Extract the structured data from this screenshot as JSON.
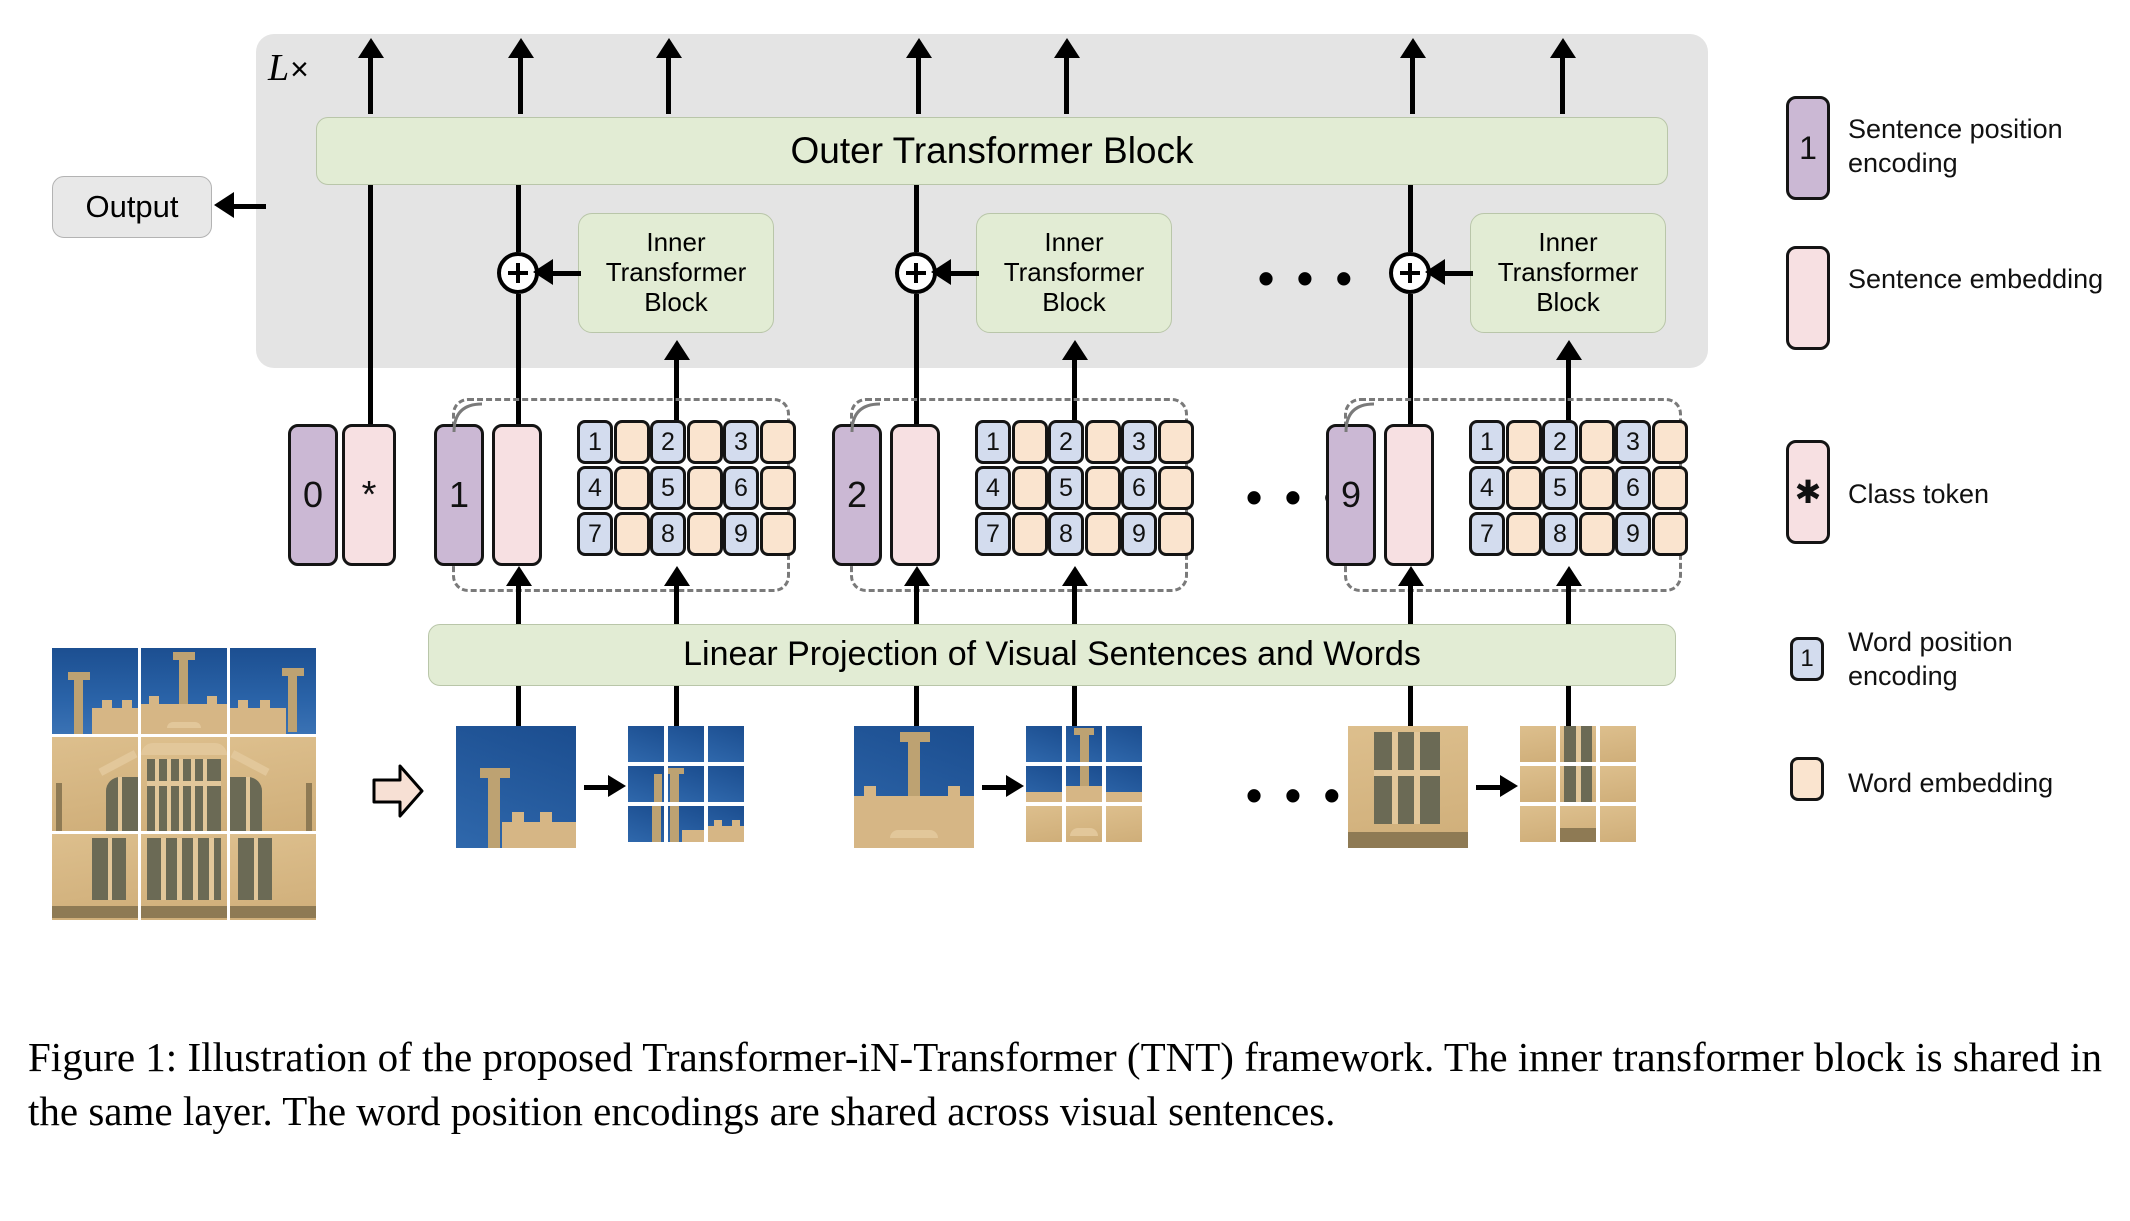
{
  "figure": {
    "caption": "Figure 1: Illustration of the proposed Transformer-iN-Transformer (TNT) framework. The inner transformer block is shared in the same layer. The word position encodings are shared across visual sentences."
  },
  "diagram": {
    "repeat_label": "L",
    "repeat_times_symbol": "×",
    "output_label": "Output",
    "outer_block_label": "Outer Transformer Block",
    "inner_block_label": "Inner Transformer Block",
    "linear_projection_label": "Linear Projection of Visual Sentences and Words",
    "ellipsis": "• • •",
    "plus_symbol": "+",
    "class_token_symbol": "✱",
    "sentence_groups": [
      {
        "position_encoding": "0",
        "sentence_embedding": "*",
        "is_class_token": true,
        "word_positions": []
      },
      {
        "position_encoding": "1",
        "sentence_embedding": "",
        "is_class_token": false,
        "word_positions": [
          "1",
          "2",
          "3",
          "4",
          "5",
          "6",
          "7",
          "8",
          "9"
        ]
      },
      {
        "position_encoding": "2",
        "sentence_embedding": "",
        "is_class_token": false,
        "word_positions": [
          "1",
          "2",
          "3",
          "4",
          "5",
          "6",
          "7",
          "8",
          "9"
        ]
      },
      {
        "position_encoding": "9",
        "sentence_embedding": "",
        "is_class_token": false,
        "word_positions": [
          "1",
          "2",
          "3",
          "4",
          "5",
          "6",
          "7",
          "8",
          "9"
        ]
      }
    ]
  },
  "legend": {
    "items": [
      {
        "symbol": "1",
        "label": "Sentence position encoding",
        "swatch": "sentence-position"
      },
      {
        "symbol": "",
        "label": "Sentence embedding",
        "swatch": "sentence-embedding"
      },
      {
        "symbol": "✱",
        "label": "Class token",
        "swatch": "class-token"
      },
      {
        "symbol": "1",
        "label": "Word position encoding",
        "swatch": "word-position"
      },
      {
        "symbol": "",
        "label": "Word embedding",
        "swatch": "word-embedding"
      }
    ]
  },
  "colors": {
    "outer_panel": "#e4e4e4",
    "green_block": "#e2ecd4",
    "sentence_position": "#cbb8d4",
    "sentence_embedding": "#f7e0e2",
    "word_position": "#d3dcee",
    "word_embedding": "#fae4cf",
    "stroke": "#141414",
    "dashed_border": "#7a7a7a"
  }
}
